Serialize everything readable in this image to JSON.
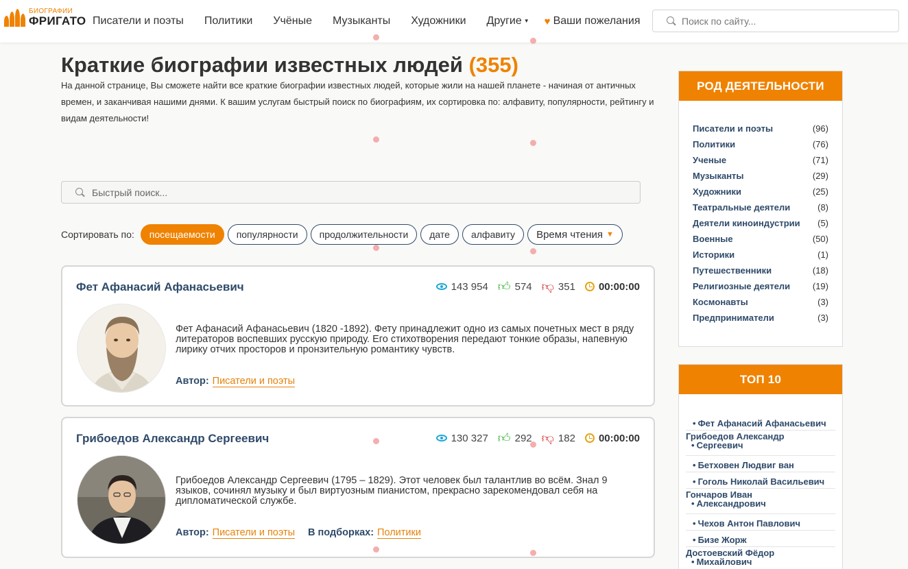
{
  "header": {
    "logo_top": "БИОГРАФИИ",
    "logo_bottom": "ФРИГАТО",
    "nav": [
      "Писатели и поэты",
      "Политики",
      "Учёные",
      "Музыканты",
      "Художники",
      "Другие"
    ],
    "wish_label": "Ваши пожелания",
    "search_placeholder": "Поиск по сайту..."
  },
  "main": {
    "title": "Краткие биографии известных людей",
    "count": "(355)",
    "description": "На данной странице, Вы сможете найти все краткие биографии известных людей, которые жили на нашей планете - начиная от античных времен, и заканчивая нашими днями. К вашим услугам быстрый поиск по биографиям, их сортировка по: алфавиту, популярности, рейтингу и видам деятельности!",
    "quick_search_placeholder": "Быстрый поиск...",
    "sort_label": "Сортировать по:",
    "sort_options": [
      "посещаемости",
      "популярности",
      "продолжительности",
      "дате",
      "алфавиту",
      "Время чтения"
    ],
    "cards": [
      {
        "name": "Фет Афанасий Афанасьевич",
        "views": "143 954",
        "likes": "574",
        "dislikes": "351",
        "read_time": "00:00:00",
        "text": "Фет Афанасий Афанасьевич (1820 -1892). Фету принадлежит одно из самых почетных мест в ряду литераторов воспевших русскую природу. Его стихотворения передают тонкие образы, напевную лирику отчих просторов и пронзительную романтику чувств.",
        "author_label": "Автор:",
        "author_link": "Писатели и поэты"
      },
      {
        "name": "Грибоедов Александр Сергеевич",
        "views": "130 327",
        "likes": "292",
        "dislikes": "182",
        "read_time": "00:00:00",
        "text": "Грибоедов Александр Сергеевич (1795 – 1829). Этот человек был талантлив во всём. Знал 9 языков, сочинял музыку и был виртуозным пианистом, прекрасно зарекомендовал себя на дипломатической службе.",
        "author_label": "Автор:",
        "author_link": "Писатели и поэты",
        "collection_label": "В подборках:",
        "collection_link": "Политики"
      }
    ]
  },
  "sidebar": {
    "categories_title": "РОД ДЕЯТЕЛЬНОСТИ",
    "categories": [
      {
        "name": "Писатели и поэты",
        "count": "(96)"
      },
      {
        "name": "Политики",
        "count": "(76)"
      },
      {
        "name": "Ученые",
        "count": "(71)"
      },
      {
        "name": "Музыканты",
        "count": "(29)"
      },
      {
        "name": "Художники",
        "count": "(25)"
      },
      {
        "name": "Театральные деятели",
        "count": "(8)"
      },
      {
        "name": "Деятели киноиндустрии",
        "count": "(5)"
      },
      {
        "name": "Военные",
        "count": "(50)"
      },
      {
        "name": "Историки",
        "count": "(1)"
      },
      {
        "name": "Путешественники",
        "count": "(18)"
      },
      {
        "name": "Религиозные деятели",
        "count": "(19)"
      },
      {
        "name": "Космонавты",
        "count": "(3)"
      },
      {
        "name": "Предприниматели",
        "count": "(3)"
      }
    ],
    "top_title": "ТОП 10",
    "top": [
      {
        "line1": "Фет Афанасий Афанасьевич"
      },
      {
        "line1": "Грибоедов Александр",
        "line2": "Сергеевич"
      },
      {
        "line1": "Бетховен Людвиг ван"
      },
      {
        "line1": "Гоголь Николай Васильевич"
      },
      {
        "line1": "Гончаров Иван",
        "line2": "Александрович"
      },
      {
        "line1": "Чехов Антон Павлович"
      },
      {
        "line1": "Бизе Жорж"
      },
      {
        "line1": "Достоевский Фёдор",
        "line2": "Михайлович"
      }
    ]
  }
}
